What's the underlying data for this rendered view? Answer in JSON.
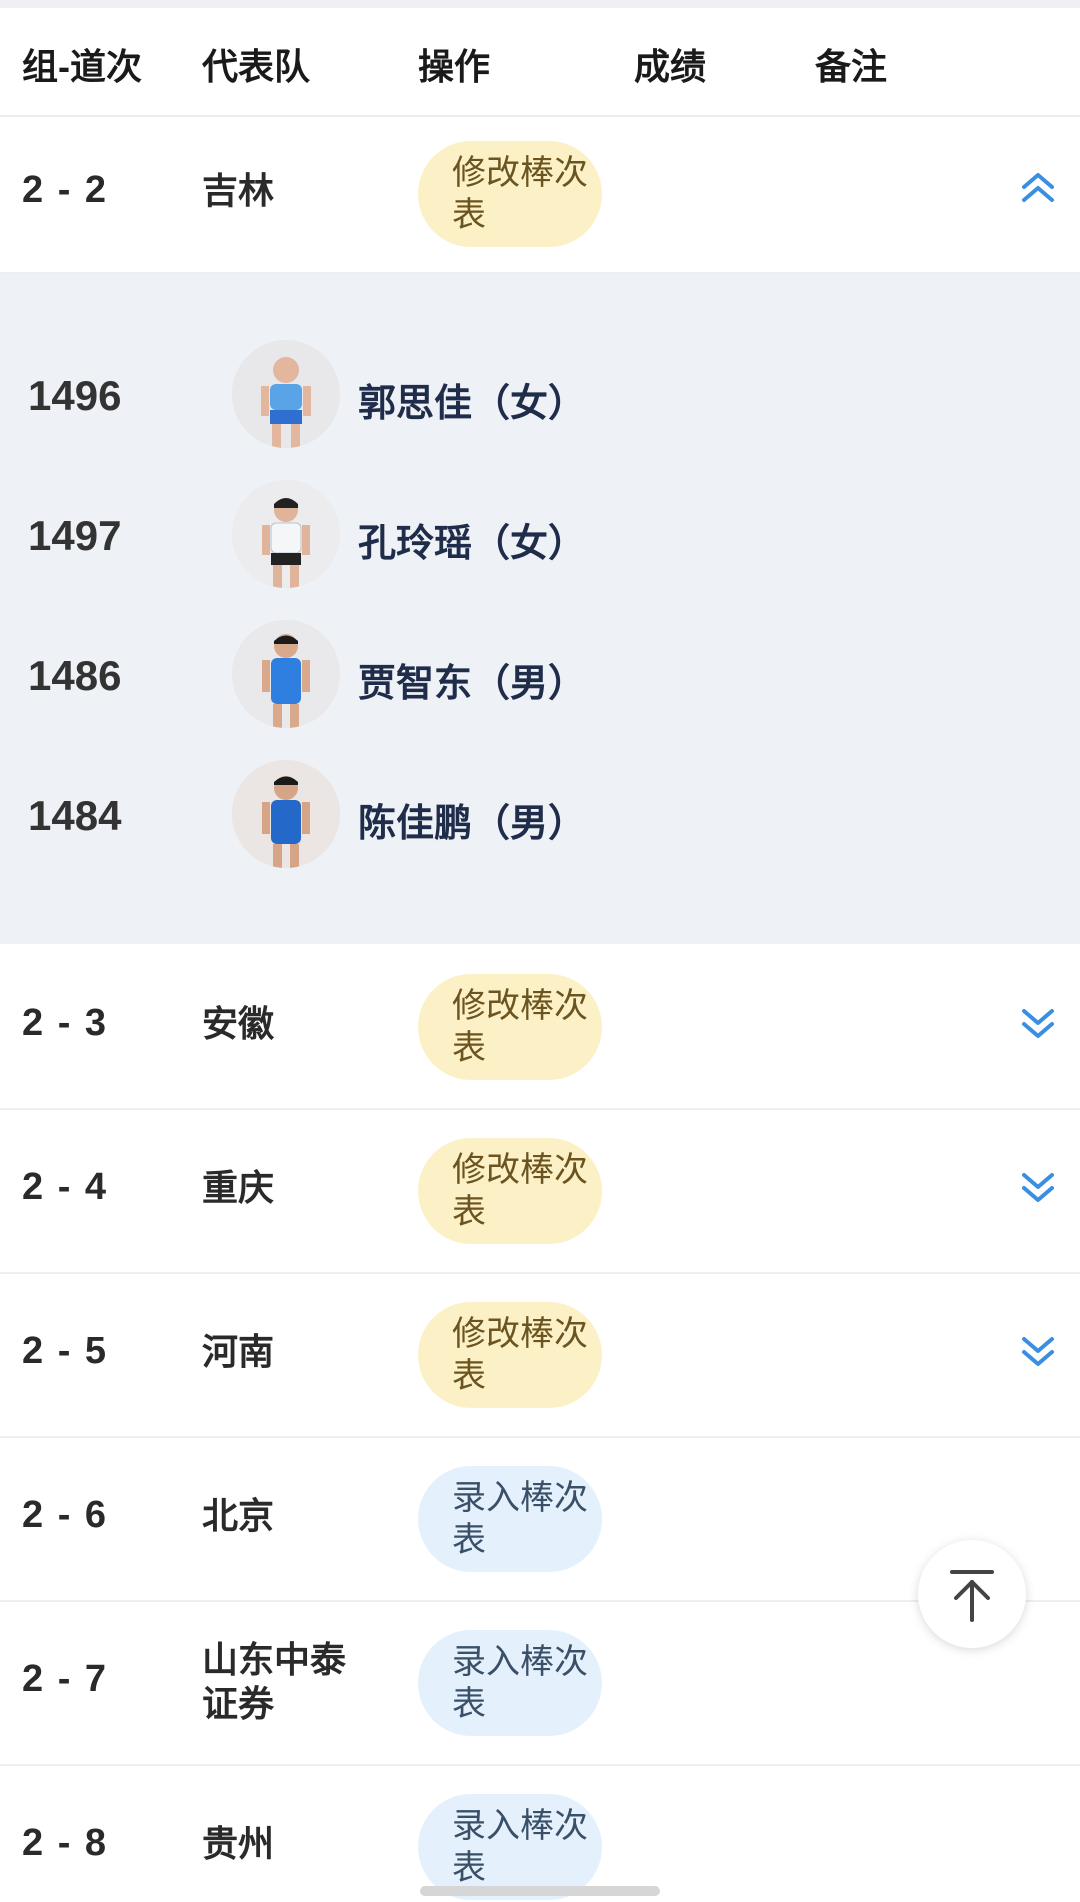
{
  "header": {
    "col_lane": "组-道次",
    "col_team": "代表队",
    "col_action": "操作",
    "col_result": "成绩",
    "col_remark": "备注"
  },
  "rows": [
    {
      "lane": "2 - 2",
      "team": "吉林",
      "action": "修改棒次表",
      "expanded": true
    },
    {
      "lane": "2 - 3",
      "team": "安徽",
      "action": "修改棒次表",
      "expanded": false
    },
    {
      "lane": "2 - 4",
      "team": "重庆",
      "action": "修改棒次表",
      "expanded": false
    },
    {
      "lane": "2 - 5",
      "team": "河南",
      "action": "修改棒次表",
      "expanded": false
    },
    {
      "lane": "2 - 6",
      "team": "北京",
      "action": "录入棒次表"
    },
    {
      "lane": "2 - 7",
      "team": "山东中泰证券",
      "action": "录入棒次表"
    },
    {
      "lane": "2 - 8",
      "team": "贵州",
      "action": "录入棒次表"
    }
  ],
  "athletes": [
    {
      "bib": "1496",
      "name": "郭思佳（女）",
      "kit": "light-blue"
    },
    {
      "bib": "1497",
      "name": "孔玲瑶（女）",
      "kit": "white-top"
    },
    {
      "bib": "1486",
      "name": "贾智东（男）",
      "kit": "blue"
    },
    {
      "bib": "1484",
      "name": "陈佳鹏（男）",
      "kit": "blue"
    }
  ],
  "icons": {
    "collapse": "chevron-double-up-icon",
    "expand": "chevron-double-down-icon",
    "back_to_top": "arrow-up-to-top-icon"
  },
  "colors": {
    "edit_pill_bg": "#fcf1c6",
    "enter_pill_bg": "#e4f1fc",
    "chevron": "#3a8fe0",
    "expanded_bg": "#eef1f6"
  }
}
